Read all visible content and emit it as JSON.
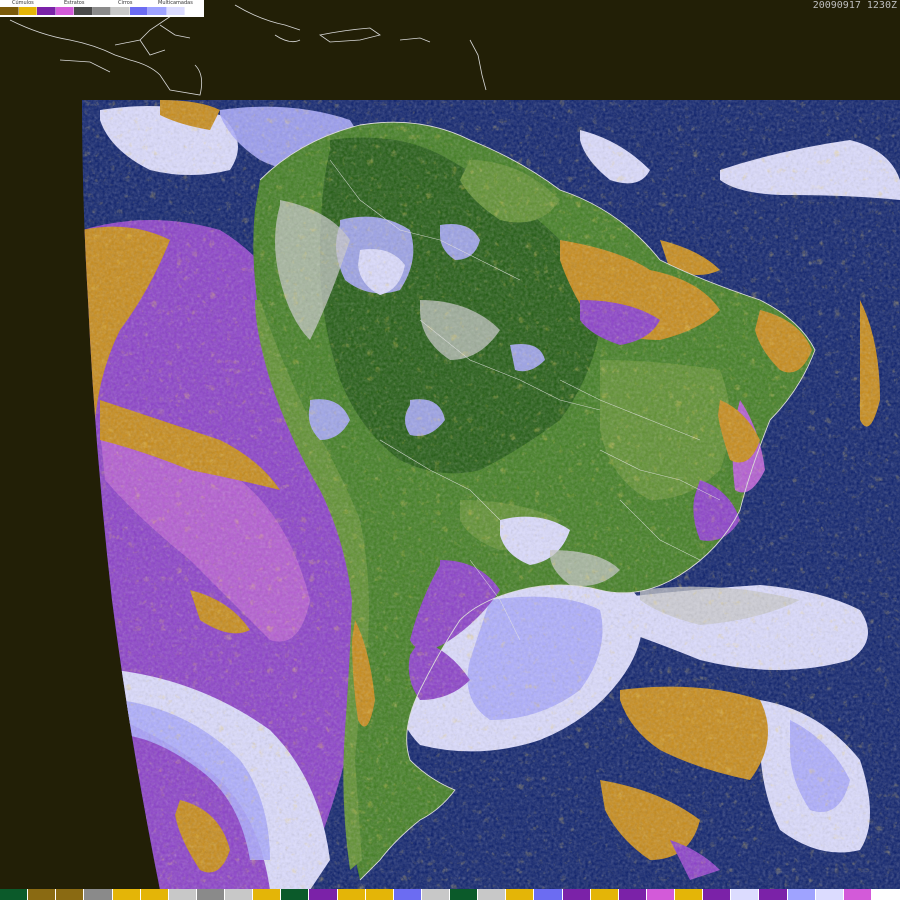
{
  "timestamp": "20090917 1230Z",
  "legend": {
    "groups": [
      {
        "label": "Cúmulos",
        "colors": [
          "#7a5a0a",
          "#e4b507"
        ]
      },
      {
        "label": "Estratos",
        "colors": [
          "#7b22a8",
          "#d35ad9"
        ]
      },
      {
        "label": "Cirros",
        "colors": [
          "#4a4a4a",
          "#8a8a8a",
          "#c8c8c8"
        ]
      },
      {
        "label": "Multicamadas",
        "colors": [
          "#6c6cf2",
          "#9fa3ff",
          "#dcdcff",
          "#ffffff"
        ]
      }
    ]
  },
  "colors": {
    "space": "#221f06",
    "ocean": "#0a1e6b",
    "land_dark": "#1f5a0f",
    "land": "#3f7d1f",
    "land_light": "#5d8f2e",
    "estratos": "#8a3ec9",
    "estratos_light": "#b35ad2",
    "cumulos": "#c78a17",
    "cumulos_light": "#e3b307",
    "multi_light": "#dcdcff",
    "multi_mid": "#a9a9ff",
    "multi_dark": "#6f6ff0",
    "cirros": "#c8c8c8",
    "coast": "#e0e0e0"
  },
  "colorbar": [
    "#0b5a2a",
    "#8a6a12",
    "#8a6a12",
    "#8a8a8a",
    "#e4b507",
    "#e4b507",
    "#c8c8c8",
    "#8a8a8a",
    "#c8c8c8",
    "#e4b507",
    "#0b5a2a",
    "#7b22a8",
    "#e4b507",
    "#e4b507",
    "#6c6cf2",
    "#c8c8c8",
    "#0b5a2a",
    "#c8c8c8",
    "#e4b507",
    "#6c6cf2",
    "#7b22a8",
    "#e4b507",
    "#7b22a8",
    "#d35ad9",
    "#e4b507",
    "#7b22a8",
    "#dcdcff",
    "#7b22a8",
    "#9fa3ff",
    "#dcdcff",
    "#d35ad9",
    "#ffffff"
  ]
}
